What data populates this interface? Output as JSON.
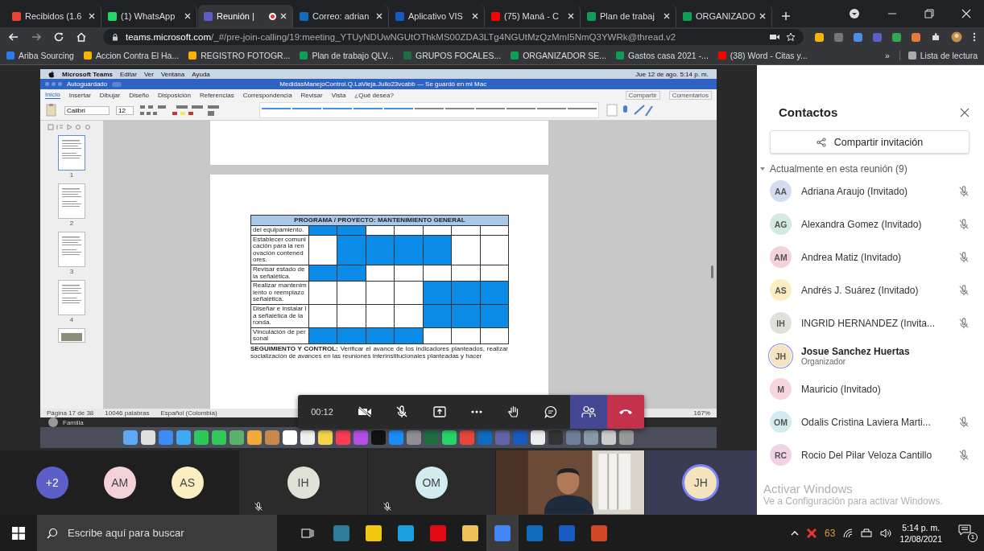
{
  "browser": {
    "tabs": [
      {
        "label": "Recibidos (1.6",
        "selected": false
      },
      {
        "label": "(1) WhatsApp",
        "selected": false
      },
      {
        "label": "Reunión |",
        "selected": true,
        "recording": true
      },
      {
        "label": "Correo: adrian",
        "selected": false
      },
      {
        "label": "Aplicativo VIS",
        "selected": false
      },
      {
        "label": "(75) Maná - C",
        "selected": false
      },
      {
        "label": "Plan de trabaj",
        "selected": false
      },
      {
        "label": "ORGANIZADO",
        "selected": false
      }
    ],
    "url_host": "teams.microsoft.com",
    "url_path": "/_#/pre-join-calling/19:meeting_YTUyNDUwNGUtOThkMS00ZDA3LTg4NGUtMzQzMmI5NmQ3YWRk@thread.v2",
    "bookmarks": [
      "Ariba Sourcing",
      "Accion Contra El Ha...",
      "REGISTRO FOTOGR...",
      "Plan de trabajo QLV...",
      "GRUPOS FOCALES...",
      "ORGANIZADOR SE...",
      "Gastos casa 2021 -...",
      "(38) Word - Citas y..."
    ],
    "more_bookmarks": "»",
    "reading_list": "Lista de lectura"
  },
  "shared_screen": {
    "menu_bar": {
      "app": "Microsoft Teams",
      "menus": [
        "Editar",
        "Ver",
        "Ventana",
        "Ayuda"
      ],
      "clock": "Jue 12 de ago. 5:14 p. m."
    },
    "word": {
      "autosave": "Autoguardado",
      "autosave_on": false,
      "title": "MedidasManejoControl.Q.LaVieja.Julio23vcabb — Se guardó en mi Mac",
      "ribbon_tabs": [
        {
          "label": "Inicio",
          "selected": true
        },
        {
          "label": "Insertar",
          "selected": false
        },
        {
          "label": "Dibujar",
          "selected": false
        },
        {
          "label": "Diseño",
          "selected": false
        },
        {
          "label": "Disposición",
          "selected": false
        },
        {
          "label": "Referencias",
          "selected": false
        },
        {
          "label": "Correspondencia",
          "selected": false
        },
        {
          "label": "Revisar",
          "selected": false
        },
        {
          "label": "Vista",
          "selected": false
        }
      ],
      "tell_me": "¿Qué desea?",
      "share": "Compartir",
      "comments": "Comentarios",
      "font": "Calibri",
      "font_size": "12",
      "thumbnails": [
        "1",
        "2",
        "3",
        "4"
      ],
      "table": {
        "title": "PROGRAMA / PROYECTO: MANTENIMIENTO GENERAL",
        "rows": [
          {
            "activity": "del equipamiento.",
            "filled": [
              true,
              true,
              false,
              false,
              false,
              false,
              false
            ]
          },
          {
            "activity": "Establecer comunicación para la renovación contenedores.",
            "filled": [
              false,
              true,
              true,
              true,
              true,
              false,
              false
            ]
          },
          {
            "activity": "Revisar estado de la señalética.",
            "filled": [
              true,
              true,
              false,
              false,
              false,
              false,
              false
            ]
          },
          {
            "activity": "Realizar mantenimiento o reemplazo señalética.",
            "filled": [
              false,
              false,
              false,
              false,
              true,
              true,
              true
            ]
          },
          {
            "activity": "Diseñar e instalar la señalética de la ronda.",
            "filled": [
              false,
              false,
              false,
              false,
              true,
              true,
              true
            ]
          },
          {
            "activity": "Vinculación de personal",
            "filled": [
              true,
              true,
              true,
              true,
              false,
              false,
              false
            ]
          }
        ]
      },
      "paragraph": "**SEGUIMIENTO Y CONTROL:** Verificar el avance de los indicadores planteados, realizar socialización de avances en las reuniones interinstitucionales planteadas y hacer",
      "status": [
        "Página 17 de 38",
        "10046 palabras",
        "Español (Colombia)"
      ],
      "zoom": "167%"
    },
    "chat_preview": "Familia"
  },
  "call_controls": {
    "timer": "00:12",
    "buttons": [
      {
        "kind": "camera",
        "off": true
      },
      {
        "kind": "mic",
        "off": true
      },
      {
        "kind": "share"
      },
      {
        "kind": "more"
      },
      {
        "kind": "hand"
      },
      {
        "kind": "chat"
      },
      {
        "kind": "people",
        "selected": true
      },
      {
        "kind": "hangup"
      }
    ]
  },
  "gallery": {
    "more": "+2",
    "avatars": [
      {
        "initials": "AM",
        "color": "#f3d3d8"
      },
      {
        "initials": "AS",
        "color": "#fbeec0"
      }
    ],
    "tiles": [
      {
        "kind": "avatar",
        "initials": "IH",
        "color": "#dfe2d9",
        "muted": true,
        "speaking": false
      },
      {
        "kind": "avatar",
        "initials": "OM",
        "color": "#d2ecef",
        "muted": true,
        "speaking": false
      },
      {
        "kind": "video"
      },
      {
        "kind": "avatar",
        "initials": "JH",
        "color": "#f5e4bd",
        "muted": false,
        "speaking": true
      }
    ]
  },
  "contacts": {
    "title": "Contactos",
    "share_button": "Compartir invitación",
    "section": "Actualmente en esta reunión (9)",
    "expanded": true,
    "people": [
      {
        "initials": "AA",
        "name": "Adriana Araujo (Invitado)",
        "color": "#d4dcef",
        "muted": true
      },
      {
        "initials": "AG",
        "name": "Alexandra Gomez (Invitado)",
        "color": "#d3ebdf",
        "muted": true
      },
      {
        "initials": "AM",
        "name": "Andrea Matiz (Invitado)",
        "color": "#f3d3d8",
        "muted": true
      },
      {
        "initials": "AS",
        "name": "Andrés J. Suárez (Invitado)",
        "color": "#fbeec0",
        "muted": true
      },
      {
        "initials": "IH",
        "name": "INGRID HERNANDEZ (Invita...",
        "color": "#dfe2d9",
        "muted": true
      },
      {
        "initials": "JH",
        "name": "Josue Sanchez Huertas",
        "role": "Organizador",
        "color": "#f5e4bd",
        "muted": false,
        "speaking": true
      },
      {
        "initials": "M",
        "name": "Mauricio (Invitado)",
        "color": "#f6d5dc",
        "muted": false
      },
      {
        "initials": "OM",
        "name": "Odalis Cristina Laviera Marti...",
        "color": "#d2ecef",
        "muted": true
      },
      {
        "initials": "RC",
        "name": "Rocio Del Pilar Veloza Cantillo",
        "color": "#f1d3e6",
        "muted": true
      }
    ]
  },
  "activation_notice": {
    "title": "Activar Windows",
    "text": "Ve a Configuración para activar Windows."
  },
  "taskbar": {
    "search_placeholder": "Escribe aquí para buscar",
    "temperature": "63",
    "time": "5:14 p. m.",
    "date": "12/08/2021",
    "notifications": "1"
  }
}
